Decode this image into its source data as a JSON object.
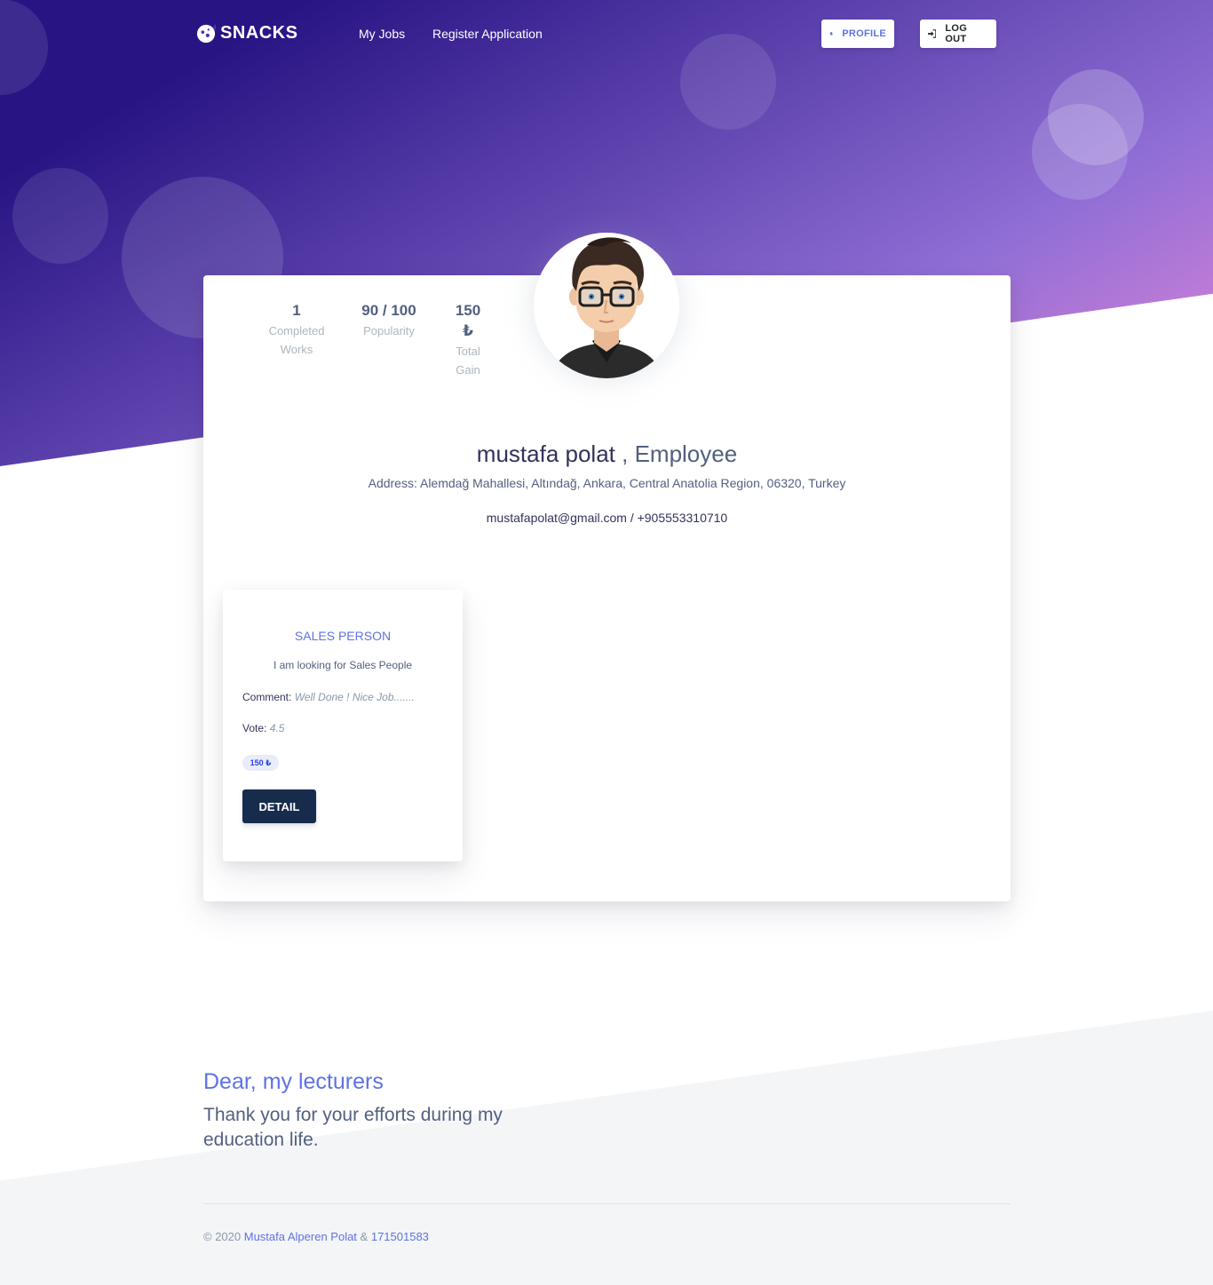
{
  "brand": {
    "name": "SNACKS",
    "icon": "snack-logo-icon"
  },
  "nav": {
    "my_jobs": "My Jobs",
    "register_application": "Register Application",
    "profile_label": "PROFILE",
    "profile_icon": "bell-icon",
    "logout_label": "LOG OUT",
    "logout_icon": "sign-in-icon"
  },
  "profile": {
    "stats": [
      {
        "value": "1",
        "label": "Completed Works"
      },
      {
        "value": "90 / 100",
        "label": "Popularity"
      },
      {
        "value": "150 ₺",
        "label": "Total Gain"
      }
    ],
    "name": "mustafa polat",
    "separator": " , ",
    "role": "Employee",
    "address": "Address: Alemdağ Mahallesi, Altındağ, Ankara, Central Anatolia Region, 06320, Turkey",
    "contact": "mustafapolat@gmail.com / +905553310710"
  },
  "jobs": [
    {
      "title": "SALES PERSON",
      "description": "I am looking for Sales People",
      "comment_label": "Comment:",
      "comment": "Well Done ! Nice Job.......",
      "vote_label": "Vote:",
      "vote": "4.5",
      "price": "150 ₺",
      "button": "DETAIL"
    }
  ],
  "footer": {
    "heading": "Dear, my lecturers",
    "sub": "Thank you for your efforts during my education life.",
    "copyright_prefix": "© 2020 ",
    "author": "Mustafa Alperen Polat",
    "amp": " & ",
    "student_id": "171501583"
  },
  "colors": {
    "primary": "#5e72e4",
    "dark": "#172b4d",
    "gradient_start": "#281483",
    "gradient_mid": "#8f6ed5",
    "gradient_end": "#d782d9"
  }
}
